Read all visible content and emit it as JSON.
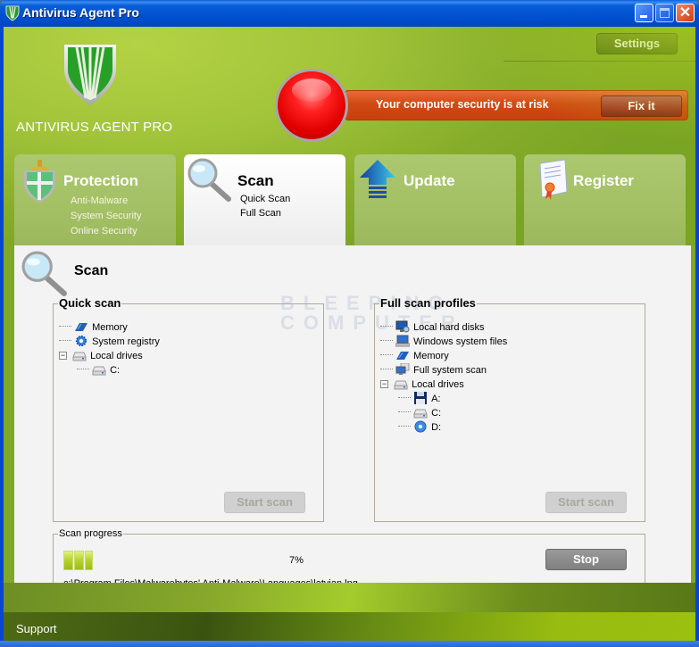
{
  "window": {
    "title": "Antivirus Agent Pro",
    "controls": {
      "minimize": "minimize",
      "maximize": "maximize",
      "close": "✕"
    }
  },
  "header": {
    "logo_text": "ANTIVIRUS AGENT PRO",
    "settings_label": "Settings",
    "alert": {
      "message": "Your computer security is at risk",
      "fix_label": "Fix it",
      "status_color": "#e00000"
    }
  },
  "tabs": [
    {
      "id": "protection",
      "label": "Protection",
      "icon": "shield-sword-icon",
      "items": [
        "Anti-Malware",
        "System Security",
        "Online Security"
      ],
      "active": false
    },
    {
      "id": "scan",
      "label": "Scan",
      "icon": "magnifier-icon",
      "items": [
        "Quick Scan",
        "Full Scan"
      ],
      "active": true
    },
    {
      "id": "update",
      "label": "Update",
      "icon": "up-arrow-icon",
      "items": [],
      "active": false
    },
    {
      "id": "register",
      "label": "Register",
      "icon": "certificate-icon",
      "items": [],
      "active": false
    }
  ],
  "content": {
    "title": "Scan",
    "watermark": [
      "BLEEPING",
      "COMPUTER"
    ],
    "quick_scan": {
      "legend": "Quick scan",
      "items": [
        {
          "label": "Memory",
          "icon": "memory-icon"
        },
        {
          "label": "System registry",
          "icon": "registry-gear-icon"
        },
        {
          "label": "Local drives",
          "icon": "drive-icon",
          "expanded": true,
          "children": [
            {
              "label": "C:",
              "icon": "drive-icon"
            }
          ]
        }
      ],
      "start_label": "Start scan"
    },
    "full_scan": {
      "legend": "Full scan profiles",
      "items": [
        {
          "label": "Local hard disks",
          "icon": "monitor-search-icon"
        },
        {
          "label": "Windows system files",
          "icon": "computer-icon"
        },
        {
          "label": "Memory",
          "icon": "memory-icon"
        },
        {
          "label": "Full system scan",
          "icon": "network-computer-icon"
        },
        {
          "label": "Local drives",
          "icon": "drive-icon",
          "expanded": true,
          "children": [
            {
              "label": "A:",
              "icon": "floppy-icon"
            },
            {
              "label": "C:",
              "icon": "drive-icon"
            },
            {
              "label": "D:",
              "icon": "cd-icon"
            }
          ]
        }
      ],
      "start_label": "Start scan"
    },
    "progress": {
      "legend": "Scan progress",
      "percent_text": "7%",
      "percent": 7,
      "current_file": "c:\\Program Files\\Malwarebytes' Anti-Malware\\Languages\\latvian.lng",
      "stop_label": "Stop"
    }
  },
  "footer": {
    "support_label": "Support"
  },
  "colors": {
    "brand_green": "#86ad2a",
    "alert_orange": "#d04a14",
    "titlebar_blue": "#0050d0"
  }
}
